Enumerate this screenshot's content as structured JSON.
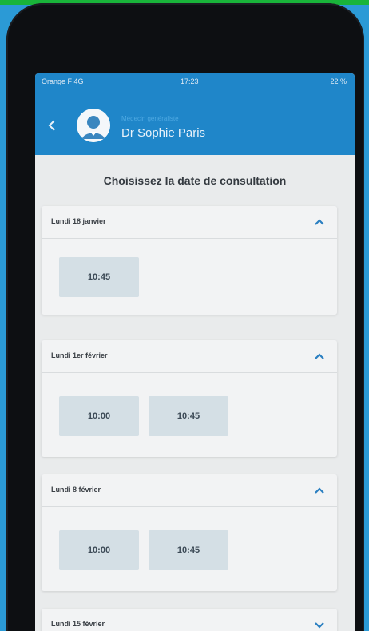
{
  "status_bar": {
    "carrier": "Orange F 4G",
    "time": "17:23",
    "battery": "22 %"
  },
  "header": {
    "subtitle": "Médecin généraliste",
    "doctor_name": "Dr Sophie Paris"
  },
  "page_title": "Choisissez la date de consultation",
  "days": [
    {
      "date": "Lundi 18 janvier",
      "expanded": true,
      "slots": [
        "10:45"
      ]
    },
    {
      "date": "Lundi 1er février",
      "expanded": true,
      "slots": [
        "10:00",
        "10:45"
      ]
    },
    {
      "date": "Lundi 8 février",
      "expanded": true,
      "slots": [
        "10:00",
        "10:45"
      ]
    },
    {
      "date": "Lundi 15 février",
      "expanded": false,
      "slots": []
    }
  ],
  "colors": {
    "header": "#1f86c9",
    "background": "#e9ebec",
    "slot": "#d4dfe5",
    "chevron": "#2a7fc1"
  },
  "icons": {
    "back": "chevron-left-icon",
    "collapse": "chevron-up-icon",
    "expand": "chevron-down-icon",
    "avatar": "doctor-avatar-icon"
  }
}
